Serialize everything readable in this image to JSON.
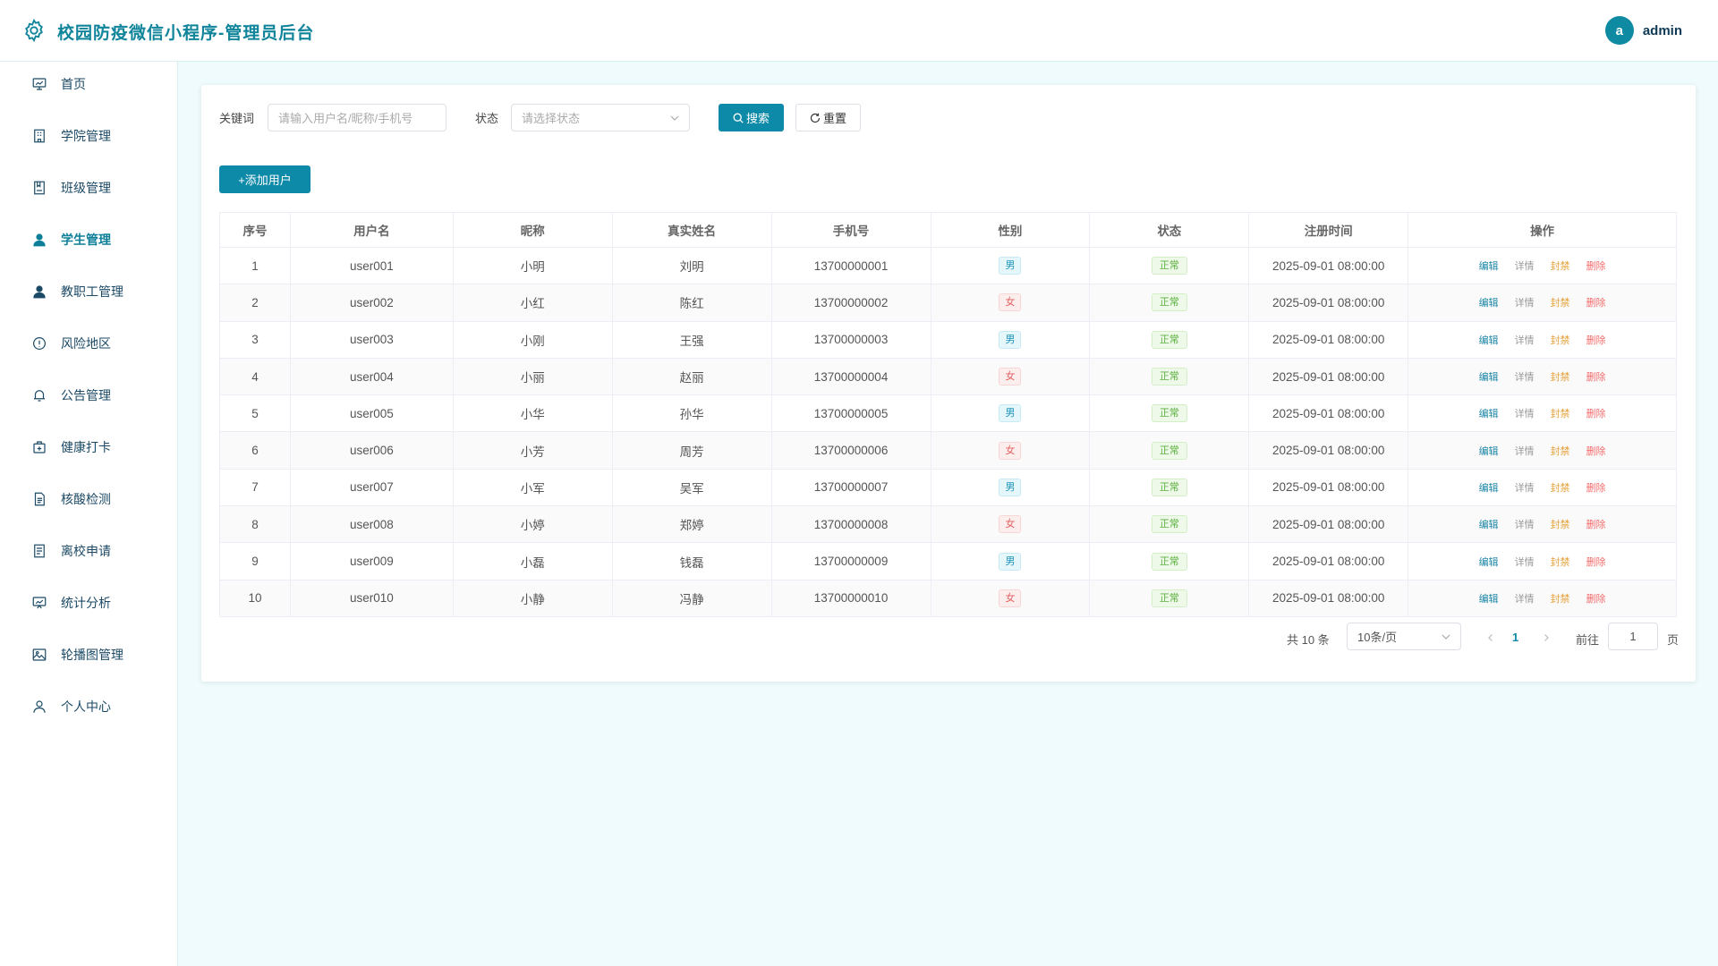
{
  "header": {
    "title": "校园防疫微信小程序-管理员后台",
    "avatar_letter": "a",
    "username": "admin"
  },
  "sidebar": {
    "items": [
      {
        "label": "首页",
        "icon": "dashboard-icon"
      },
      {
        "label": "学院管理",
        "icon": "building-icon"
      },
      {
        "label": "班级管理",
        "icon": "bookmark-icon"
      },
      {
        "label": "学生管理",
        "icon": "user-filled-icon"
      },
      {
        "label": "教职工管理",
        "icon": "user-filled-icon"
      },
      {
        "label": "风险地区",
        "icon": "warning-circle-icon"
      },
      {
        "label": "公告管理",
        "icon": "bell-icon"
      },
      {
        "label": "健康打卡",
        "icon": "medical-box-icon"
      },
      {
        "label": "核酸检测",
        "icon": "document-icon"
      },
      {
        "label": "离校申请",
        "icon": "list-document-icon"
      },
      {
        "label": "统计分析",
        "icon": "chart-board-icon"
      },
      {
        "label": "轮播图管理",
        "icon": "picture-icon"
      },
      {
        "label": "个人中心",
        "icon": "user-outline-icon"
      }
    ],
    "active_index": 3
  },
  "filters": {
    "keyword_label": "关键词",
    "keyword_placeholder": "请输入用户名/昵称/手机号",
    "status_label": "状态",
    "status_placeholder": "请选择状态",
    "search_label": "搜索",
    "reset_label": "重置"
  },
  "toolbar": {
    "add_label": "+添加用户"
  },
  "table": {
    "columns": [
      "序号",
      "用户名",
      "昵称",
      "真实姓名",
      "手机号",
      "性别",
      "状态",
      "注册时间",
      "操作"
    ],
    "rows": [
      {
        "index": "1",
        "username": "user001",
        "nickname": "小明",
        "realname": "刘明",
        "phone": "13700000001",
        "gender": "男",
        "status": "正常",
        "time": "2025-09-01 08:00:00"
      },
      {
        "index": "2",
        "username": "user002",
        "nickname": "小红",
        "realname": "陈红",
        "phone": "13700000002",
        "gender": "女",
        "status": "正常",
        "time": "2025-09-01 08:00:00"
      },
      {
        "index": "3",
        "username": "user003",
        "nickname": "小刚",
        "realname": "王强",
        "phone": "13700000003",
        "gender": "男",
        "status": "正常",
        "time": "2025-09-01 08:00:00"
      },
      {
        "index": "4",
        "username": "user004",
        "nickname": "小丽",
        "realname": "赵丽",
        "phone": "13700000004",
        "gender": "女",
        "status": "正常",
        "time": "2025-09-01 08:00:00"
      },
      {
        "index": "5",
        "username": "user005",
        "nickname": "小华",
        "realname": "孙华",
        "phone": "13700000005",
        "gender": "男",
        "status": "正常",
        "time": "2025-09-01 08:00:00"
      },
      {
        "index": "6",
        "username": "user006",
        "nickname": "小芳",
        "realname": "周芳",
        "phone": "13700000006",
        "gender": "女",
        "status": "正常",
        "time": "2025-09-01 08:00:00"
      },
      {
        "index": "7",
        "username": "user007",
        "nickname": "小军",
        "realname": "吴军",
        "phone": "13700000007",
        "gender": "男",
        "status": "正常",
        "time": "2025-09-01 08:00:00"
      },
      {
        "index": "8",
        "username": "user008",
        "nickname": "小婷",
        "realname": "郑婷",
        "phone": "13700000008",
        "gender": "女",
        "status": "正常",
        "time": "2025-09-01 08:00:00"
      },
      {
        "index": "9",
        "username": "user009",
        "nickname": "小磊",
        "realname": "钱磊",
        "phone": "13700000009",
        "gender": "男",
        "status": "正常",
        "time": "2025-09-01 08:00:00"
      },
      {
        "index": "10",
        "username": "user010",
        "nickname": "小静",
        "realname": "冯静",
        "phone": "13700000010",
        "gender": "女",
        "status": "正常",
        "time": "2025-09-01 08:00:00"
      }
    ],
    "actions": [
      "编辑",
      "详情",
      "封禁",
      "删除"
    ]
  },
  "pagination": {
    "total_text": "共 10 条",
    "page_size": "10条/页",
    "current_page": "1",
    "goto_label": "前往",
    "goto_value": "1",
    "page_suffix": "页"
  },
  "colors": {
    "brand": "#0e8aa9",
    "background": "#effbfc"
  }
}
